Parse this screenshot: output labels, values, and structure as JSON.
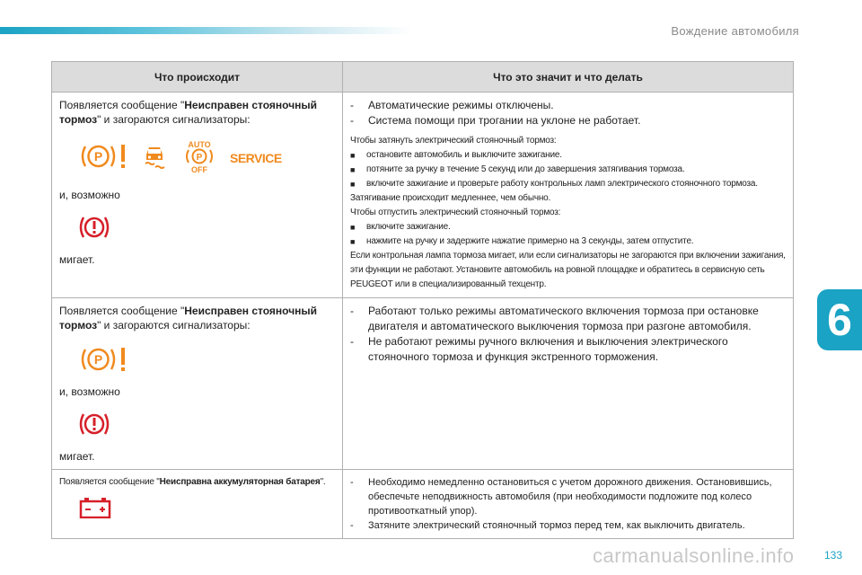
{
  "header": {
    "section_title": "Вождение автомобиля"
  },
  "chapter": {
    "number": "6"
  },
  "page": {
    "number": "133"
  },
  "watermark": "carmanualsonline.info",
  "table": {
    "col_headers": [
      "Что происходит",
      "Что это значит и что делать"
    ],
    "rows": [
      {
        "left": {
          "msg_prefix": "Появляется сообщение \"",
          "msg_bold": "Неисправен стояночный тормоз",
          "msg_suffix": "\" и загораются сигнализаторы:",
          "and_possibly": "и, возможно",
          "blinks": "мигает."
        },
        "right": {
          "dash_items": [
            "Автоматические режимы отключены.",
            "Система помощи при трогании на уклоне не работает."
          ],
          "para1": "Чтобы затянуть электрический стояночный тормоз:",
          "bullets1": [
            "остановите автомобиль и выключите зажигание.",
            "потяните за ручку в течение 5 секунд или до завершения затягивания тормоза.",
            "включите зажигание и проверьте работу контрольных ламп электрического стояночного тормоза."
          ],
          "para2": "Затягивание происходит медленнее, чем обычно.",
          "para3": "Чтобы отпустить электрический стояночный тормоз:",
          "bullets2": [
            "включите зажигание.",
            "нажмите на ручку и задержите нажатие примерно на 3 секунды, затем отпустите."
          ],
          "para4": "Если контрольная лампа тормоза мигает, или если сигнализаторы не загораются при включении зажигания, эти функции не работают. Установите автомобиль на ровной площадке и обратитесь в сервисную сеть PEUGEOT или в специализированный техцентр."
        }
      },
      {
        "left": {
          "msg_prefix": "Появляется сообщение \"",
          "msg_bold": "Неисправен стояночный тормоз",
          "msg_suffix": "\" и загораются сигнализаторы:",
          "and_possibly": "и, возможно",
          "blinks": "мигает."
        },
        "right": {
          "dash_items": [
            "Работают только режимы автоматического включения тормоза при остановке двигателя и автоматического выключения тормоза при разгоне автомобиля.",
            "Не работают режимы ручного включения и выключения электрического стояночного тормоза и функция экстренного торможения."
          ]
        }
      },
      {
        "left": {
          "msg_prefix": "Появляется сообщение \"",
          "msg_bold": "Неисправна аккумуляторная батарея",
          "msg_suffix": "\"."
        },
        "right": {
          "dash_items": [
            "Необходимо немедленно остановиться с учетом дорожного движения. Остановившись, обеспечьте неподвижность автомобиля (при необходимости подложите под колесо противооткатный упор).",
            "Затяните электрический стояночный тормоз перед тем, как выключить двигатель."
          ]
        }
      }
    ]
  },
  "icons": {
    "parking_brake_warning": "parking-brake-warning-icon",
    "esp_skid": "esp-skid-icon",
    "auto_park_off": "auto-park-off-icon",
    "service": "service-icon",
    "service_text": "SERVICE",
    "auto_text": "AUTO",
    "off_text": "OFF",
    "p_letter": "P",
    "brake_fault": "brake-fault-icon",
    "battery": "battery-icon"
  },
  "colors": {
    "accent": "#1aa3c4",
    "warning_orange": "#f08a1e",
    "alert_red": "#d6202a",
    "header_bg": "#dcdcdc"
  }
}
